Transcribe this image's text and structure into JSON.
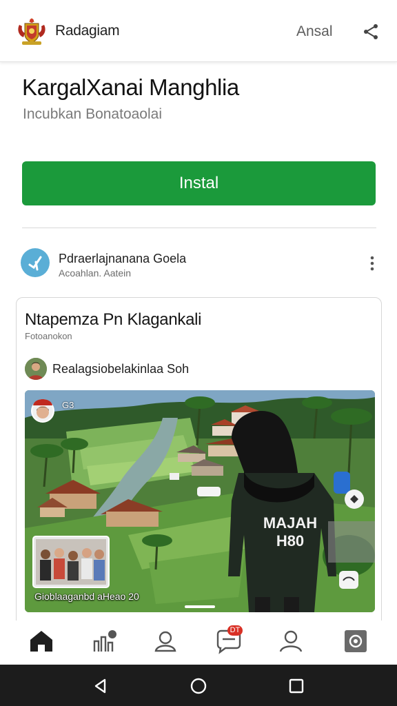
{
  "header": {
    "brand": "Radagiam",
    "action_label": "Ansal",
    "logo_icon": "coat-of-arms-icon",
    "share_icon": "share-icon"
  },
  "app": {
    "title": "KargalXanai Manghlia",
    "subtitle": "Incubkan Bonatoaolai",
    "install_label": "Instal"
  },
  "developer": {
    "name": "Pdraerlajnanana Goela",
    "sub": "Acoahlan. Aatein",
    "icon": "developer-logo-icon",
    "menu_icon": "more-vertical-icon"
  },
  "card": {
    "title": "Ntapemza Pn Klagankali",
    "subtitle": "Fotoanokon",
    "author": "Realagsiobelakinlaa Soh",
    "photo": {
      "tag": "G3",
      "shirt_text_line1": "MAJAH",
      "shirt_text_line2": "H80",
      "caption": "Gioblaaganbd aHeao 20"
    }
  },
  "bottom_nav": [
    {
      "icon": "home-icon",
      "active": true
    },
    {
      "icon": "chart-icon",
      "active": false
    },
    {
      "icon": "profile-icon",
      "active": false
    },
    {
      "icon": "chat-icon",
      "active": false,
      "badge": "DT"
    },
    {
      "icon": "user-icon",
      "active": false
    },
    {
      "icon": "settings-icon",
      "active": false
    }
  ],
  "system_nav": [
    "back-icon",
    "home-circle-icon",
    "recents-icon"
  ],
  "colors": {
    "primary_green": "#1b9a3b",
    "badge_red": "#d93025",
    "dev_icon_blue": "#5aaed6"
  }
}
